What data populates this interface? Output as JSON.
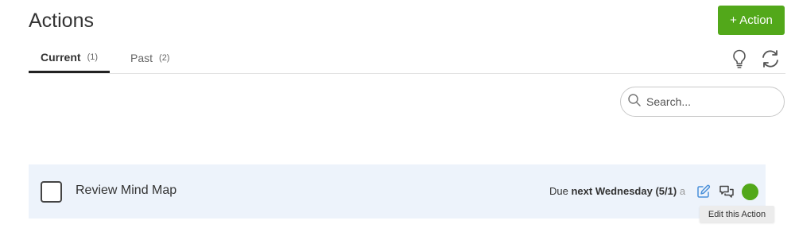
{
  "header": {
    "title": "Actions",
    "add_button_label": "+ Action"
  },
  "tabs": [
    {
      "label": "Current",
      "count": "(1)",
      "active": true
    },
    {
      "label": "Past",
      "count": "(2)",
      "active": false
    }
  ],
  "toolbar": {
    "icons": [
      "lightbulb-icon",
      "refresh-icon"
    ]
  },
  "search": {
    "placeholder": "Search...",
    "value": ""
  },
  "actions": [
    {
      "title": "Review Mind Map",
      "due_prefix": "Due",
      "due_date": "next Wednesday (5/1)",
      "due_suffix": "a",
      "status_color": "#52a81a"
    }
  ],
  "tooltip": {
    "text": "Edit this Action"
  },
  "colors": {
    "accent": "#52a81a",
    "row_background": "#edf3fb",
    "icon_blue": "#4a90d9"
  }
}
